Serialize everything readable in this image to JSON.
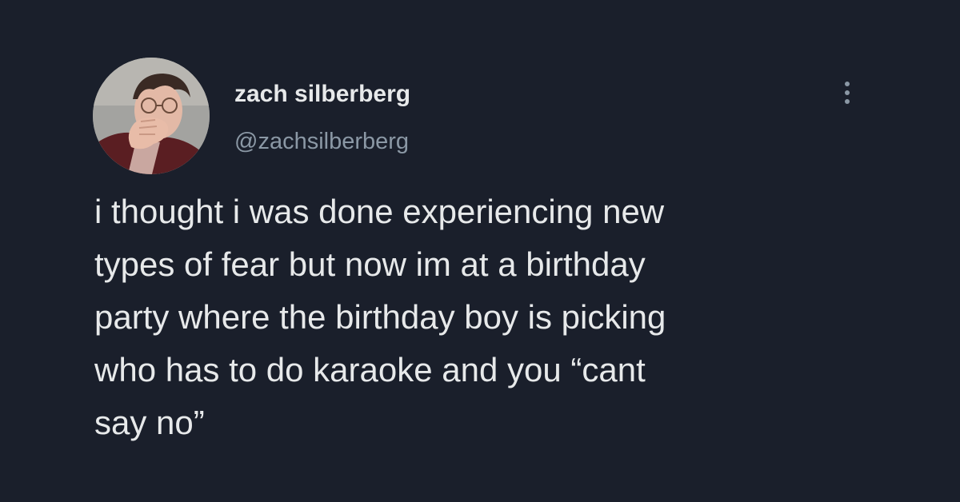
{
  "author": {
    "display_name": "zach silberberg",
    "handle": "@zachsilberberg",
    "avatar_icon": "profile-photo"
  },
  "tweet": {
    "lines": [
      "i thought i was done experiencing new",
      "types of fear but now im at a birthday",
      "party where the birthday boy is picking",
      "who has to do karaoke and you “cant",
      "say no”"
    ]
  },
  "menu": {
    "icon": "more-options-icon"
  },
  "colors": {
    "background": "#1a1f2b",
    "text": "#e7e9ea",
    "secondary_text": "#8b98a5"
  }
}
